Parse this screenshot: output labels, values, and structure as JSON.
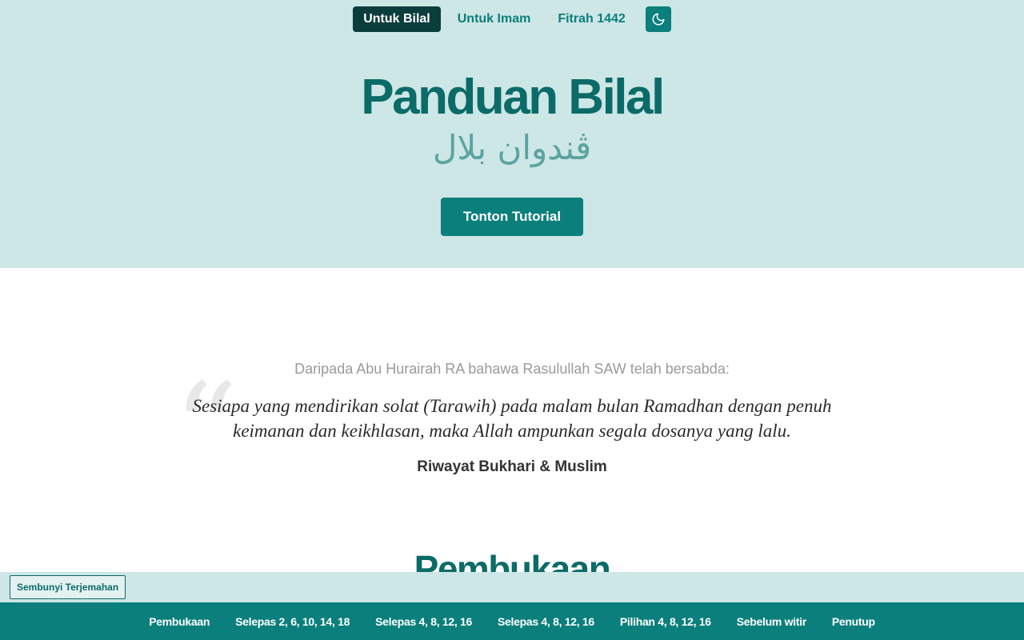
{
  "nav": {
    "tabs": [
      "Untuk Bilal",
      "Untuk Imam",
      "Fitrah 1442"
    ],
    "active": "Untuk Bilal",
    "theme_icon": "moon-icon"
  },
  "hero": {
    "title": "Panduan Bilal",
    "arabic": "ڤندوان بلال",
    "cta_label": "Tonton Tutorial"
  },
  "quote": {
    "intro": "Daripada Abu Hurairah RA bahawa Rasulullah SAW telah bersabda:",
    "mark": "“",
    "text": "Sesiapa yang mendirikan solat (Tarawih) pada malam bulan Ramadhan dengan penuh keimanan dan keikhlasan, maka Allah ampunkan segala dosanya yang lalu.",
    "source": "Riwayat Bukhari & Muslim"
  },
  "section": {
    "title": "Pembukaan"
  },
  "toggle_translation_label": "Sembunyi Terjemahan",
  "bottom_nav": [
    "Pembukaan",
    "Selepas 2, 6, 10, 14, 18",
    "Selepas 4, 8, 12, 16",
    "Selepas 4, 8, 12, 16",
    "Pilihan 4, 8, 12, 16",
    "Sebelum witir",
    "Penutup"
  ],
  "colors": {
    "primary": "#0b7f7c",
    "primary_dark": "#0b3d3d",
    "hero_bg": "#cde6e6",
    "title": "#0b6b68"
  }
}
